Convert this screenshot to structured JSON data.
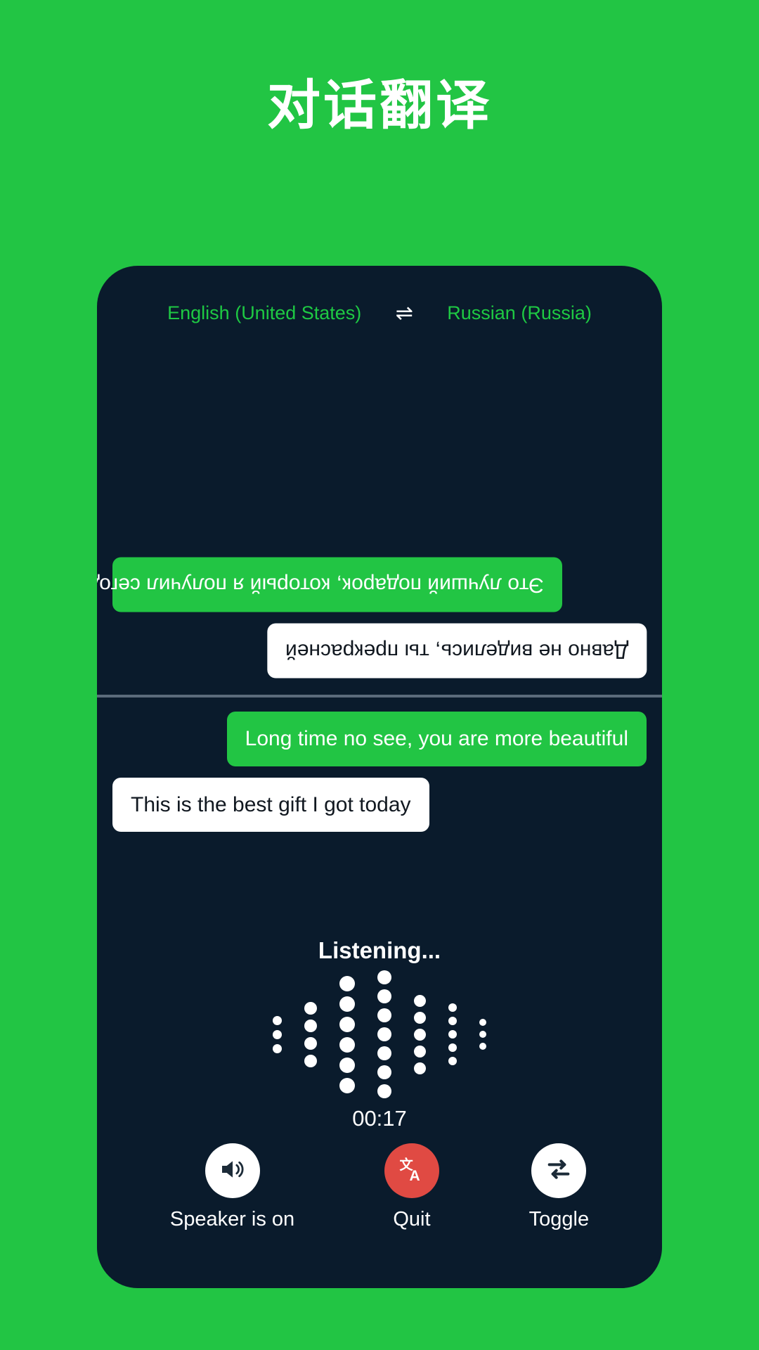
{
  "header": {
    "title": "对话翻译"
  },
  "colors": {
    "background_green": "#22c544",
    "phone_dark": "#0a1b2c",
    "accent_green": "#1ec943",
    "quit_red": "#e04a43",
    "bubble_white": "#ffffff",
    "divider_grey": "#5b6b7b"
  },
  "phone": {
    "languages": {
      "source": "English (United States)",
      "target": "Russian (Russia)",
      "swap_icon": "swap-horizontal-icon",
      "swap_glyph": "⇌"
    },
    "conversation_top": [
      {
        "text": "Это лучший подарок, который я получил сегодня",
        "style": "green",
        "align": "left",
        "rotated": true
      },
      {
        "text": "Давно не виделись, ты прекрасней",
        "style": "white",
        "align": "right",
        "rotated": true
      }
    ],
    "conversation_bottom": [
      {
        "text": "Long time no see, you are more beautiful",
        "style": "green",
        "align": "right",
        "rotated": false
      },
      {
        "text": "This is the best gift I got today",
        "style": "white",
        "align": "left",
        "rotated": false
      }
    ],
    "status": {
      "listening_label": "Listening...",
      "timer": "00:17"
    },
    "waveform": {
      "columns": [
        {
          "count": 3,
          "size": 13
        },
        {
          "count": 4,
          "size": 18
        },
        {
          "count": 6,
          "size": 22
        },
        {
          "count": 7,
          "size": 20
        },
        {
          "count": 5,
          "size": 17
        },
        {
          "count": 5,
          "size": 12
        },
        {
          "count": 3,
          "size": 10
        }
      ]
    },
    "controls": [
      {
        "label": "Speaker is on",
        "icon": "speaker-on-icon",
        "circle_style": "white"
      },
      {
        "label": "Quit",
        "icon": "translate-icon",
        "circle_style": "red"
      },
      {
        "label": "Toggle",
        "icon": "swap-arrows-icon",
        "circle_style": "white"
      }
    ]
  }
}
